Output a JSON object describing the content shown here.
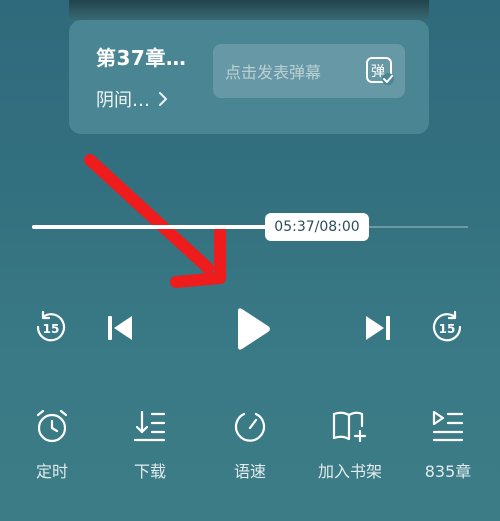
{
  "card": {
    "chapter_title": "第37章…",
    "book_name": "阴间…",
    "danmaku_placeholder": "点击发表弹幕",
    "danmaku_icon_char": "弹"
  },
  "player": {
    "time_label": "05:37/08:00",
    "progress_fraction": 0.701,
    "rewind_seconds": "15",
    "forward_seconds": "15"
  },
  "functions": [
    {
      "label": "定时",
      "icon": "alarm-clock-icon"
    },
    {
      "label": "下载",
      "icon": "download-list-icon"
    },
    {
      "label": "语速",
      "icon": "speed-gauge-icon"
    },
    {
      "label": "加入书架",
      "icon": "add-bookshelf-icon"
    },
    {
      "label": "835章",
      "icon": "chapter-list-icon"
    }
  ],
  "colors": {
    "background": "#33707f",
    "card": "#4a8594",
    "annotation_arrow": "#ee1c1c",
    "icon": "#ffffff"
  }
}
